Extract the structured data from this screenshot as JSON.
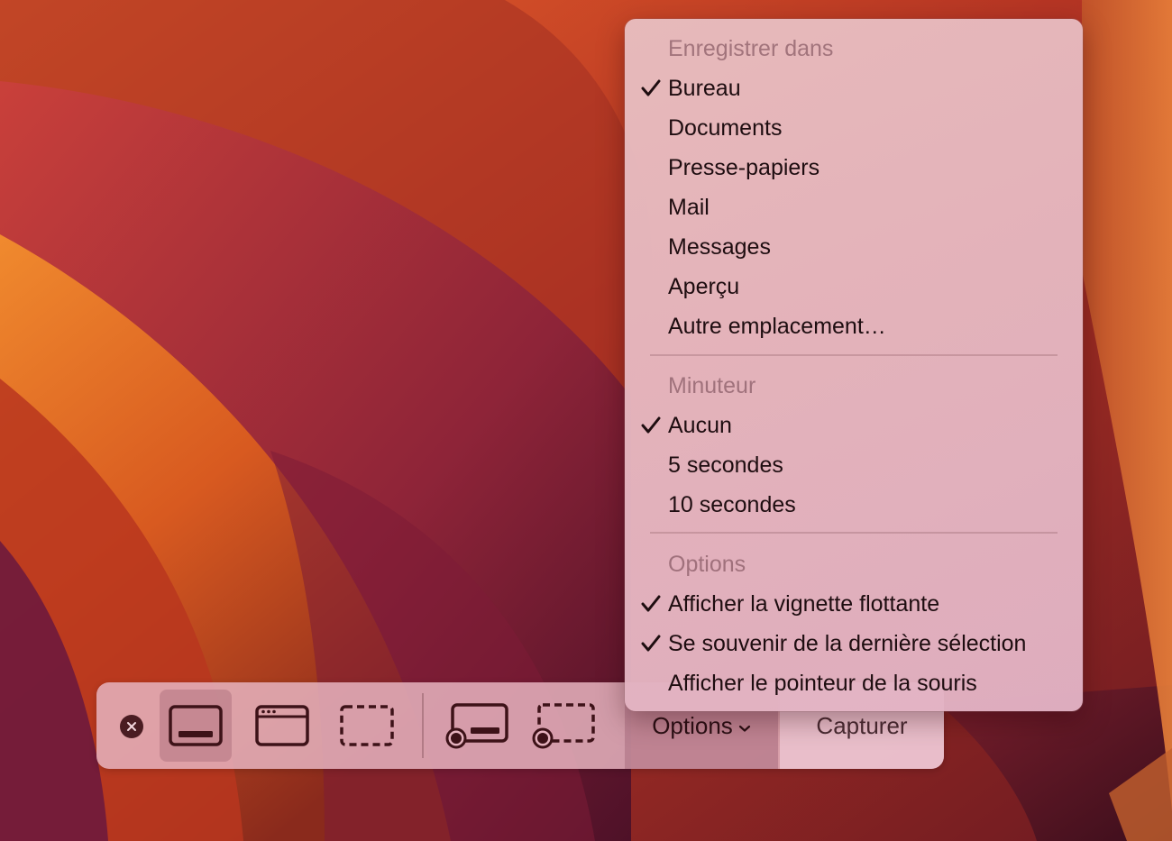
{
  "menu": {
    "save_section": {
      "header": "Enregistrer dans",
      "items": [
        {
          "label": "Bureau",
          "checked": true
        },
        {
          "label": "Documents",
          "checked": false
        },
        {
          "label": "Presse-papiers",
          "checked": false
        },
        {
          "label": "Mail",
          "checked": false
        },
        {
          "label": "Messages",
          "checked": false
        },
        {
          "label": "Aperçu",
          "checked": false
        },
        {
          "label": "Autre emplacement…",
          "checked": false
        }
      ]
    },
    "timer_section": {
      "header": "Minuteur",
      "items": [
        {
          "label": "Aucun",
          "checked": true
        },
        {
          "label": "5 secondes",
          "checked": false
        },
        {
          "label": "10 secondes",
          "checked": false
        }
      ]
    },
    "options_section": {
      "header": "Options",
      "items": [
        {
          "label": "Afficher la vignette flottante",
          "checked": true
        },
        {
          "label": "Se souvenir de la dernière sélection",
          "checked": true
        },
        {
          "label": "Afficher le pointeur de la souris",
          "checked": false
        }
      ]
    }
  },
  "toolbar": {
    "close_icon": "close-icon",
    "modes": [
      {
        "icon": "capture-entire-screen-icon",
        "selected": true
      },
      {
        "icon": "capture-window-icon",
        "selected": false
      },
      {
        "icon": "capture-selected-portion-icon",
        "selected": false
      },
      {
        "icon": "record-entire-screen-icon",
        "selected": false
      },
      {
        "icon": "record-selected-portion-icon",
        "selected": false
      }
    ],
    "options_label": "Options",
    "capture_label": "Capturer"
  },
  "colors": {
    "icon": "#3d1218",
    "menu_text": "#1e0d10",
    "menu_header": "#8a5a64"
  }
}
